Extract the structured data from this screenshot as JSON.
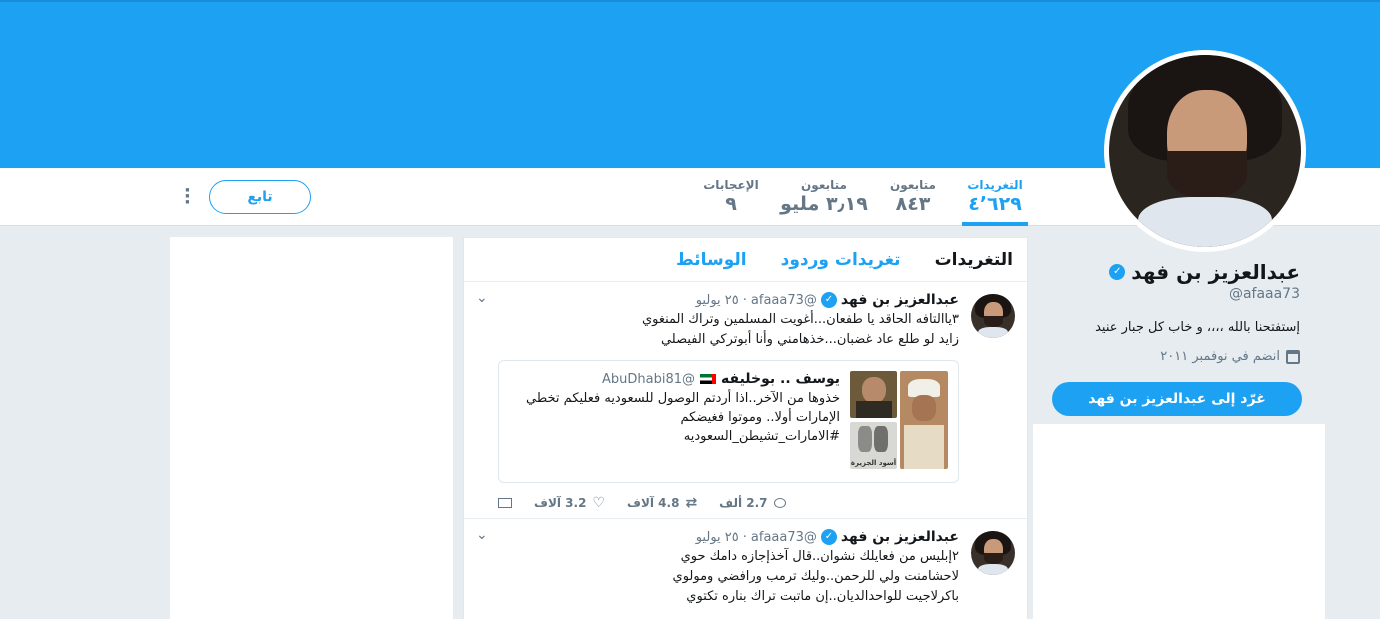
{
  "header": {
    "banner_color": "#1da1f2"
  },
  "nav": {
    "stats": [
      {
        "label": "التغريدات",
        "value": "٤٬٦٢٩",
        "active": true
      },
      {
        "label": "متابعون",
        "value": "٨٤٣"
      },
      {
        "label": "متابعون",
        "value": "٣٫١٩ مليو"
      },
      {
        "label": "الإعجابات",
        "value": "٩"
      }
    ],
    "follow_label": "تابع",
    "more_icon": "more-vertical-icon"
  },
  "profile": {
    "name": "عبدالعزيز بن فهد",
    "handle": "@afaaa73",
    "bio": "إستفتحنا بالله ،،،، و خاب كل جبار عنيد",
    "joined": "انضم في نوفمبر ٢٠١١",
    "tweet_to_label": "غرّد إلى عبدالعزيز بن فهد"
  },
  "timeline": {
    "tabs": [
      "التغريدات",
      "تغريدات وردود",
      "الوسائط"
    ],
    "tweets": [
      {
        "name": "عبدالعزيز بن فهد",
        "handle": "@afaaa73",
        "date": "٢٥ يوليو",
        "lines": [
          "٣ياالتافه الحاقد يا طفعان...أغويت المسلمين وتراك المنغوي",
          "زايد لو طلع عاد غضبان...خذهامني وأنا أبوتركي الفيصلي"
        ],
        "quote": {
          "name": "يوسف .. بوخليفه",
          "handle": "@AbuDhabi81",
          "lines": [
            "خذوها من الآخر..اذا أردتم الوصول للسعوديه فعليكم تخطي",
            "الإمارات أولا.. وموتوا فغيضكم",
            "#الامارات_تشيطن_السعوديه"
          ],
          "image_caption": "أسود الجزيرة"
        },
        "replies": "2.7 ألف",
        "retweets": "4.8 آلاف",
        "likes": "3.2 آلاف"
      },
      {
        "name": "عبدالعزيز بن فهد",
        "handle": "@afaaa73",
        "date": "٢٥ يوليو",
        "lines": [
          "٢إبليس من فعايلك نشوان..قال آخذإجازه دامك حوي",
          "لاحشامنت ولي للرحمن..وليك ترمب ورافضي ومولوي",
          "باكرلاجيت للواحدالديان..إن ماتبت تراك بناره تكتوي"
        ]
      }
    ]
  }
}
